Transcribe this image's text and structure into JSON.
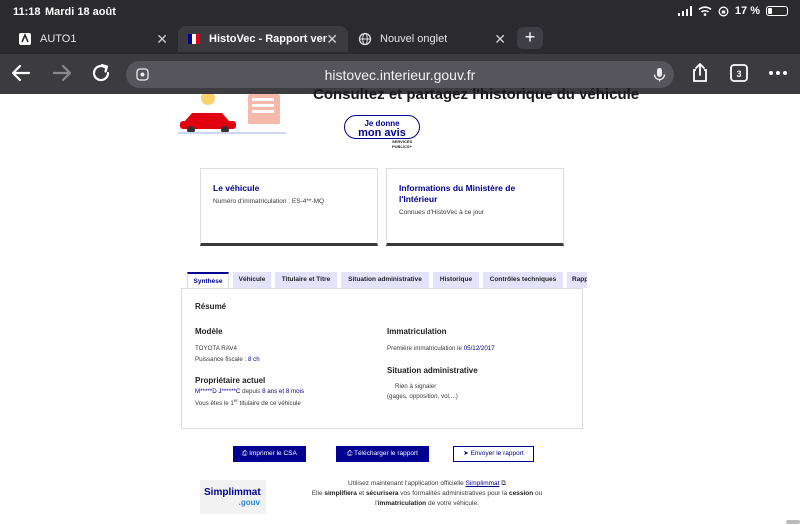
{
  "status_bar": {
    "time": "11:18",
    "date": "Mardi 18 août",
    "battery": "17 %"
  },
  "tabs": [
    {
      "label": "AUTO1",
      "icon": "auto1-favicon"
    },
    {
      "label": "HistoVec - Rapport vendeur",
      "icon": "marianne-flag-favicon",
      "active": true
    },
    {
      "label": "Nouvel onglet",
      "icon": "globe-icon"
    }
  ],
  "toolbar": {
    "url": "histovec.interieur.gouv.fr",
    "tab_count": "3"
  },
  "banner": {
    "title": "Consultez et partagez l'historique du véhicule",
    "avis_line1": "Je donne",
    "avis_line2": "mon avis",
    "services_line1": "SERVICES",
    "services_line2": "PUBLICS+"
  },
  "cards": {
    "vehicle": {
      "title": "Le véhicule",
      "desc": "Numéro d'immatriculation : ES-4**-MQ"
    },
    "ministry": {
      "title": "Informations du Ministère de l'Intérieur",
      "desc": "Connues d'HistoVec à ce jour"
    }
  },
  "report_tabs": [
    "Synthèse",
    "Véhicule",
    "Titulaire et Titre",
    "Situation administrative",
    "Historique",
    "Contrôles techniques",
    "Rapport"
  ],
  "summary": {
    "heading": "Résumé",
    "model_heading": "Modèle",
    "model_value": "TOYOTA RAV4",
    "fiscal_label": "Puissance fiscale : ",
    "fiscal_value": "8 ch",
    "owner_heading": "Propriétaire actuel",
    "owner_name": "M*****D J******C",
    "owner_since_label": " depuis ",
    "owner_since_value": "8 ans et 8 mois",
    "owner_rank_pre": "Vous êtes le 1",
    "owner_rank_sup": "er",
    "owner_rank_post": " titulaire de ce véhicule",
    "immat_heading": "Immatriculation",
    "first_immat_label": "Première immatriculation le ",
    "first_immat_value": "05/12/2017",
    "admin_heading": "Situation administrative",
    "admin_value": "Rien à signaler",
    "admin_detail": "(gages, opposition, vol,...)"
  },
  "actions": {
    "print": "Imprimer le CSA",
    "download": "Télécharger le rapport",
    "send": "Envoyer le rapport"
  },
  "simplimmat": {
    "logo_main": "Simplimmat",
    "logo_sub": ".gouv",
    "line1_pre": "Utilisez maintenant l'application officielle ",
    "link": "Simplimmat",
    "line2_pre": "Elle ",
    "line2_b1": "simplifiera",
    "line2_mid1": " et ",
    "line2_b2": "sécurisera",
    "line2_mid2": " vos formalités administratives pour la ",
    "line2_b3": "cession",
    "line2_post": " ou",
    "line3_pre": "l'",
    "line3_b": "immatriculation",
    "line3_post": " de votre véhicule."
  },
  "colors": {
    "brand_blue": "#000091",
    "chrome": "#2b2b2f",
    "toolbar": "#3b3b40"
  }
}
